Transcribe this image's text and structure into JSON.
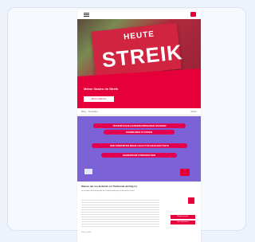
{
  "hero": {
    "sign_top": "HEUTE",
    "sign_main": "STREIK",
    "title": "Meine Gastro im Streik",
    "button": "Mehr erfahren"
  },
  "strip": {
    "left": "Blog · Aktuelles",
    "right": "Teilen"
  },
  "promo": {
    "line1": "ÖFFENTLICHE DASEINSVORSORGE SICHERN",
    "line2": "KOMMUNEN STÄRKEN",
    "line3": "WIR ERWARTEN MEHR GELD FÜR BESCHÄFTIGTE",
    "line4": "GEMEINSAM STREIKEN WIR"
  },
  "article": {
    "title": "Warum der ver.di-Streik zur Tarifrunde wichtig ist",
    "subtitle": "ver.di erklärt die Hintergründe der Tarifverhandlungen im öffentlichen Dienst",
    "footer": "Datum · Autor",
    "cta1": "Mitglied werden",
    "cta2": "Jetzt informieren"
  }
}
